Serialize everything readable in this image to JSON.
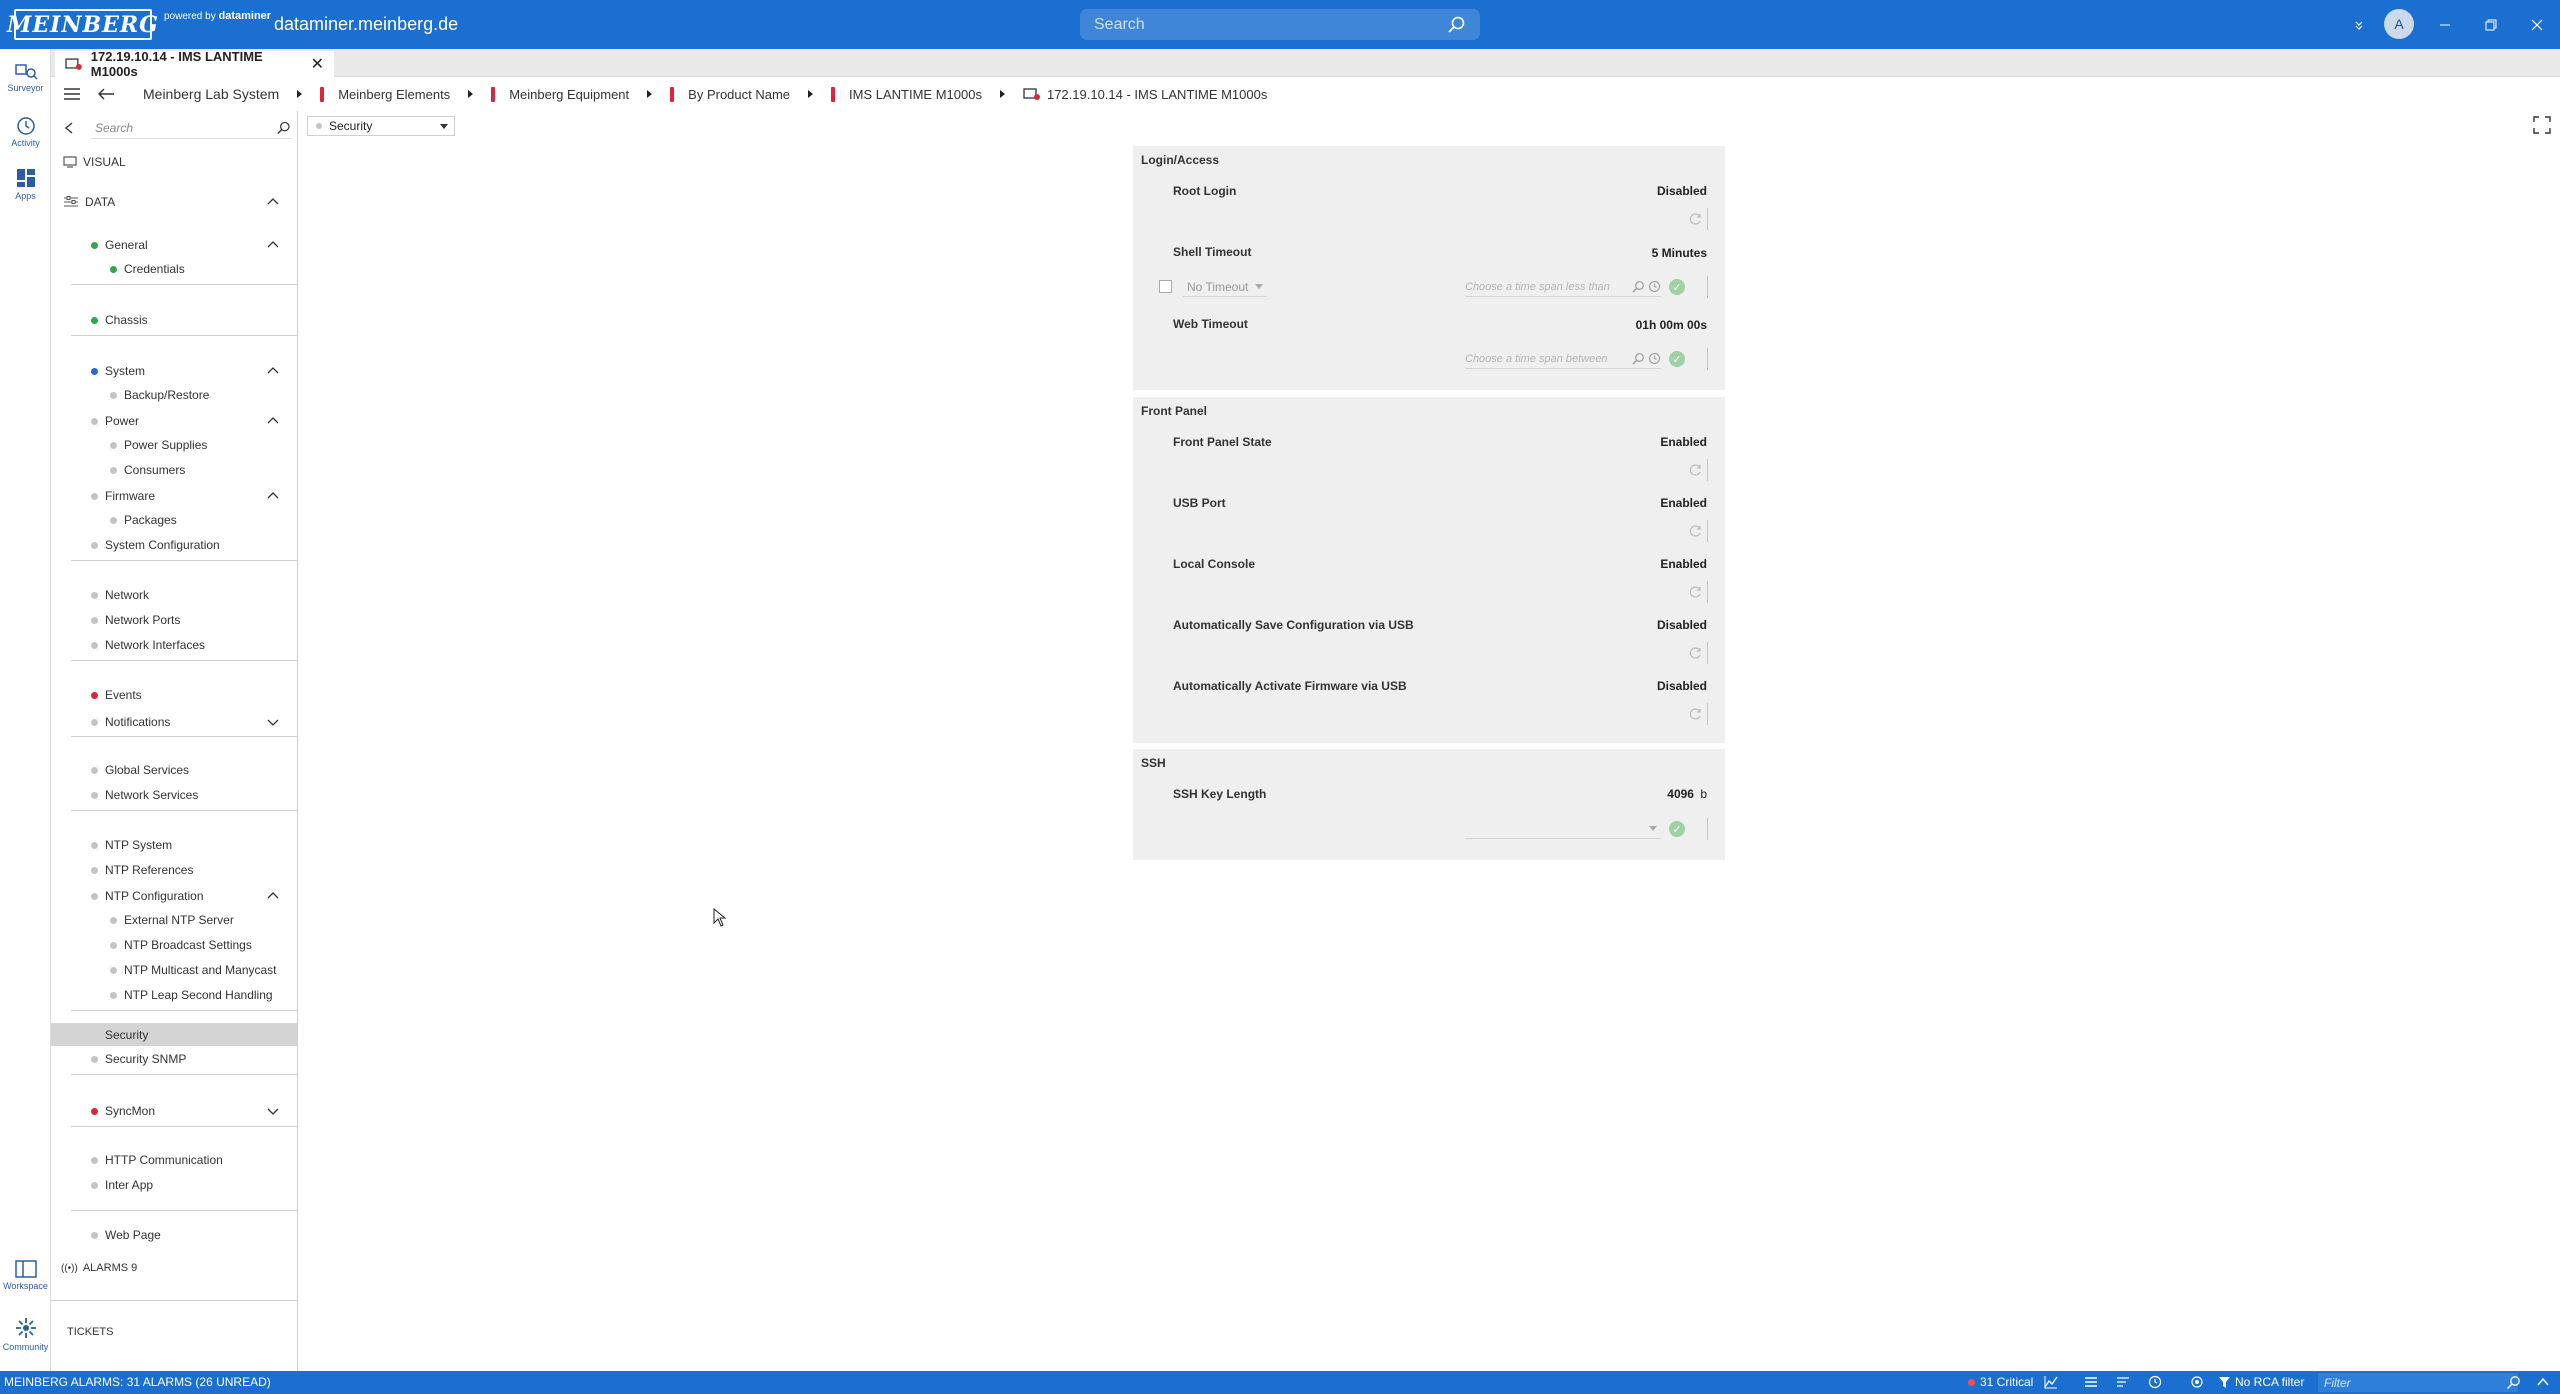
{
  "app": {
    "logo": "MEINBERG",
    "powered_by": "powered by",
    "powered_brand": "dataminer",
    "host": "dataminer.meinberg.de",
    "search_placeholder": "Search",
    "avatar_letter": "A"
  },
  "rail": {
    "items": [
      {
        "label": "Surveyor",
        "icon": "surveyor-icon"
      },
      {
        "label": "Activity",
        "icon": "activity-icon"
      },
      {
        "label": "Apps",
        "icon": "apps-icon"
      },
      {
        "label": "Workspace",
        "icon": "workspace-icon"
      },
      {
        "label": "Community",
        "icon": "community-icon"
      }
    ]
  },
  "tab": {
    "title": "172.19.10.14 - IMS LANTIME M1000s"
  },
  "breadcrumb": [
    {
      "label": "Meinberg Lab System"
    },
    {
      "label": "Meinberg Elements"
    },
    {
      "label": "Meinberg Equipment"
    },
    {
      "label": "By Product Name"
    },
    {
      "label": "IMS LANTIME M1000s"
    },
    {
      "label": "172.19.10.14 - IMS LANTIME M1000s"
    }
  ],
  "tree": {
    "search_placeholder": "Search",
    "visual": "VISUAL",
    "data": "DATA",
    "items": {
      "general": "General",
      "credentials": "Credentials",
      "chassis": "Chassis",
      "system": "System",
      "backup": "Backup/Restore",
      "power": "Power",
      "power_supplies": "Power Supplies",
      "consumers": "Consumers",
      "firmware": "Firmware",
      "packages": "Packages",
      "system_config": "System Configuration",
      "network": "Network",
      "network_ports": "Network Ports",
      "network_interfaces": "Network Interfaces",
      "events": "Events",
      "notifications": "Notifications",
      "global_services": "Global Services",
      "network_services": "Network Services",
      "ntp_system": "NTP System",
      "ntp_references": "NTP References",
      "ntp_configuration": "NTP Configuration",
      "external_ntp": "External NTP Server",
      "ntp_broadcast": "NTP Broadcast Settings",
      "ntp_multicast": "NTP Multicast and Manycast",
      "ntp_leap": "NTP Leap Second Handling",
      "security": "Security",
      "security_snmp": "Security SNMP",
      "syncmon": "SyncMon",
      "http_comm": "HTTP Communication",
      "inter_app": "Inter App",
      "web_page": "Web Page"
    },
    "alarms": "ALARMS 9",
    "tickets": "TICKETS"
  },
  "page": {
    "selector": "Security"
  },
  "login": {
    "title": "Login/Access",
    "root_login_label": "Root Login",
    "root_login_value": "Disabled",
    "shell_timeout_label": "Shell Timeout",
    "shell_timeout_value": "5 Minutes",
    "shell_timeout_option": "No Timeout",
    "shell_timeout_placeholder": "Choose a time span less than",
    "web_timeout_label": "Web Timeout",
    "web_timeout_value": "01h 00m 00s",
    "web_timeout_placeholder": "Choose a time span between"
  },
  "front_panel": {
    "title": "Front Panel",
    "rows": [
      {
        "label": "Front Panel State",
        "value": "Enabled"
      },
      {
        "label": "USB Port",
        "value": "Enabled"
      },
      {
        "label": "Local Console",
        "value": "Enabled"
      },
      {
        "label": "Automatically Save Configuration via USB",
        "value": "Disabled"
      },
      {
        "label": "Automatically Activate Firmware via USB",
        "value": "Disabled"
      }
    ]
  },
  "ssh": {
    "title": "SSH",
    "key_length_label": "SSH Key Length",
    "key_length_value": "4096",
    "key_length_unit": "b"
  },
  "status": {
    "alarms_text": "MEINBERG ALARMS: 31 ALARMS (26 UNREAD)",
    "critical": "31 Critical",
    "rca_filter": "No RCA filter",
    "filter_placeholder": "Filter"
  },
  "colors": {
    "brand_blue": "#1b6fd1",
    "critical_red": "#d9273d",
    "ok_green": "#2ea84a"
  }
}
